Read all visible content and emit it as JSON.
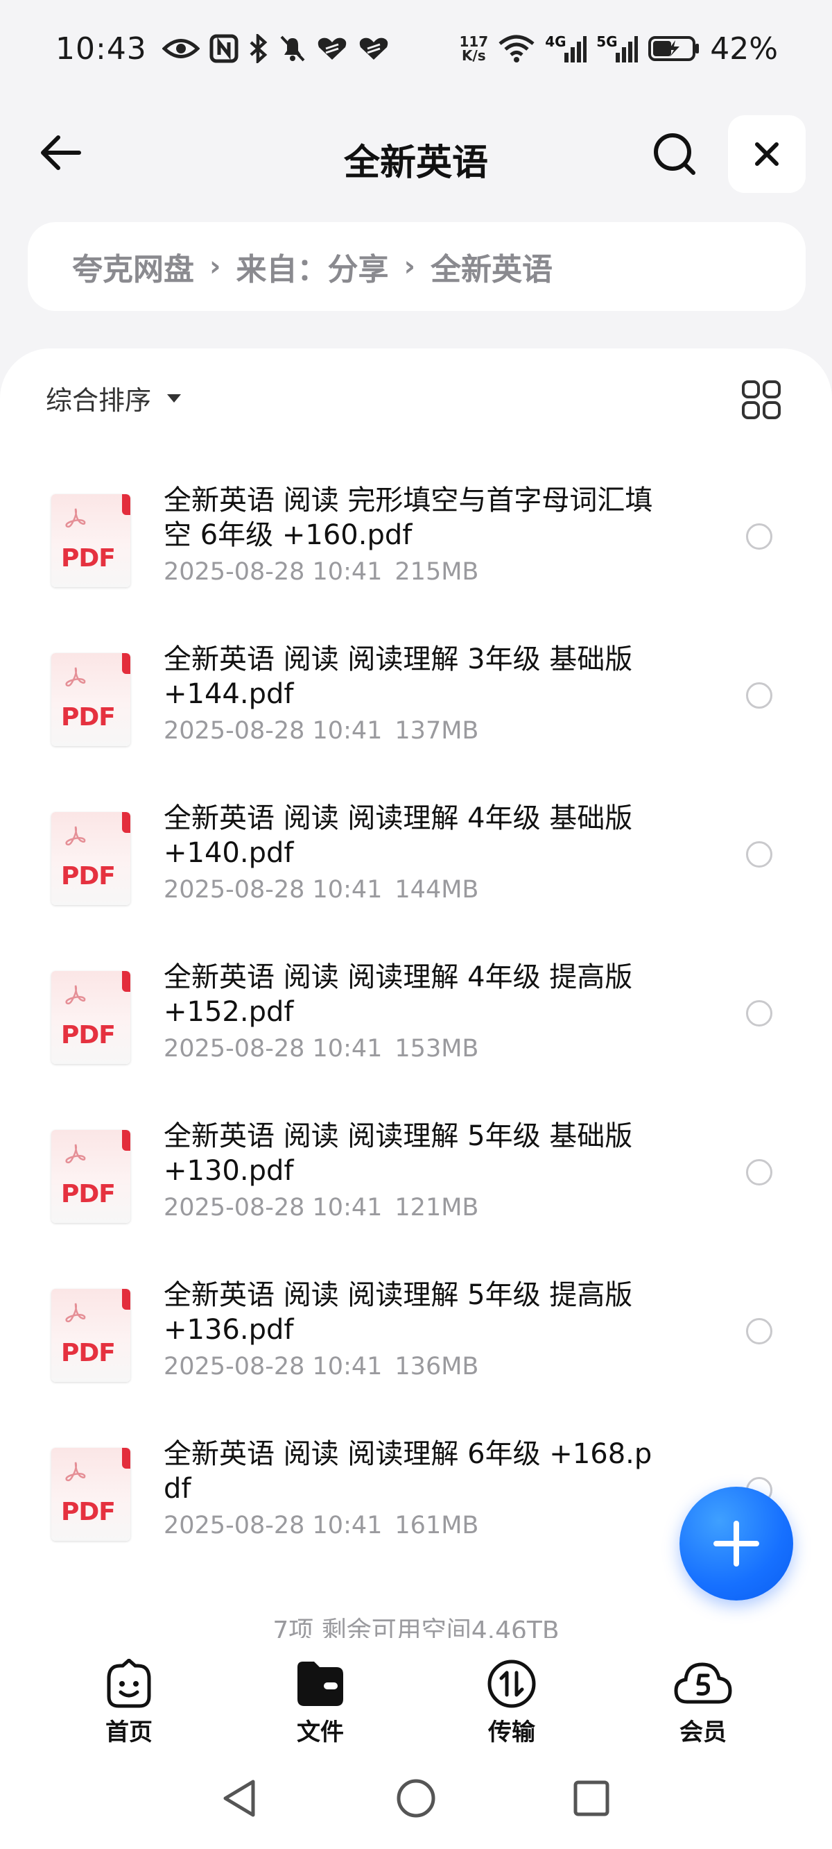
{
  "status_bar": {
    "time": "10:43",
    "net_speed_value": "117",
    "net_speed_unit": "K/s",
    "network_4g": "4G",
    "network_5g": "5G",
    "battery": "42%"
  },
  "header": {
    "title": "全新英语"
  },
  "breadcrumb": {
    "items": [
      "夸克网盘",
      "来自：分享",
      "全新英语"
    ],
    "separator": "›"
  },
  "sort": {
    "label": "综合排序"
  },
  "files": [
    {
      "name": "全新英语 阅读 完形填空与首字母词汇填空 6年级 +160.pdf",
      "date": "2025-08-28 10:41",
      "size": "215MB",
      "icon_label": "PDF"
    },
    {
      "name": "全新英语 阅读 阅读理解 3年级 基础版 +144.pdf",
      "date": "2025-08-28 10:41",
      "size": "137MB",
      "icon_label": "PDF"
    },
    {
      "name": "全新英语 阅读 阅读理解 4年级 基础版 +140.pdf",
      "date": "2025-08-28 10:41",
      "size": "144MB",
      "icon_label": "PDF"
    },
    {
      "name": "全新英语 阅读 阅读理解 4年级 提高版 +152.pdf",
      "date": "2025-08-28 10:41",
      "size": "153MB",
      "icon_label": "PDF"
    },
    {
      "name": "全新英语 阅读 阅读理解 5年级 基础版 +130.pdf",
      "date": "2025-08-28 10:41",
      "size": "121MB",
      "icon_label": "PDF"
    },
    {
      "name": "全新英语 阅读 阅读理解 5年级 提高版 +136.pdf",
      "date": "2025-08-28 10:41",
      "size": "136MB",
      "icon_label": "PDF"
    },
    {
      "name": "全新英语 阅读 阅读理解 6年级 +168.pdf",
      "date": "2025-08-28 10:41",
      "size": "161MB",
      "icon_label": "PDF"
    }
  ],
  "summary": "7项 剩余可用空间4.46TB",
  "bottom_nav": [
    {
      "label": "首页",
      "icon": "home-smile-icon"
    },
    {
      "label": "文件",
      "icon": "folder-icon"
    },
    {
      "label": "传输",
      "icon": "transfer-icon"
    },
    {
      "label": "会员",
      "icon": "cloud-member-icon"
    }
  ],
  "colors": {
    "accent": "#1670ff",
    "pdf_red": "#e5313f",
    "meta_gray": "#9a9a9e",
    "background": "#f4f4f6"
  }
}
